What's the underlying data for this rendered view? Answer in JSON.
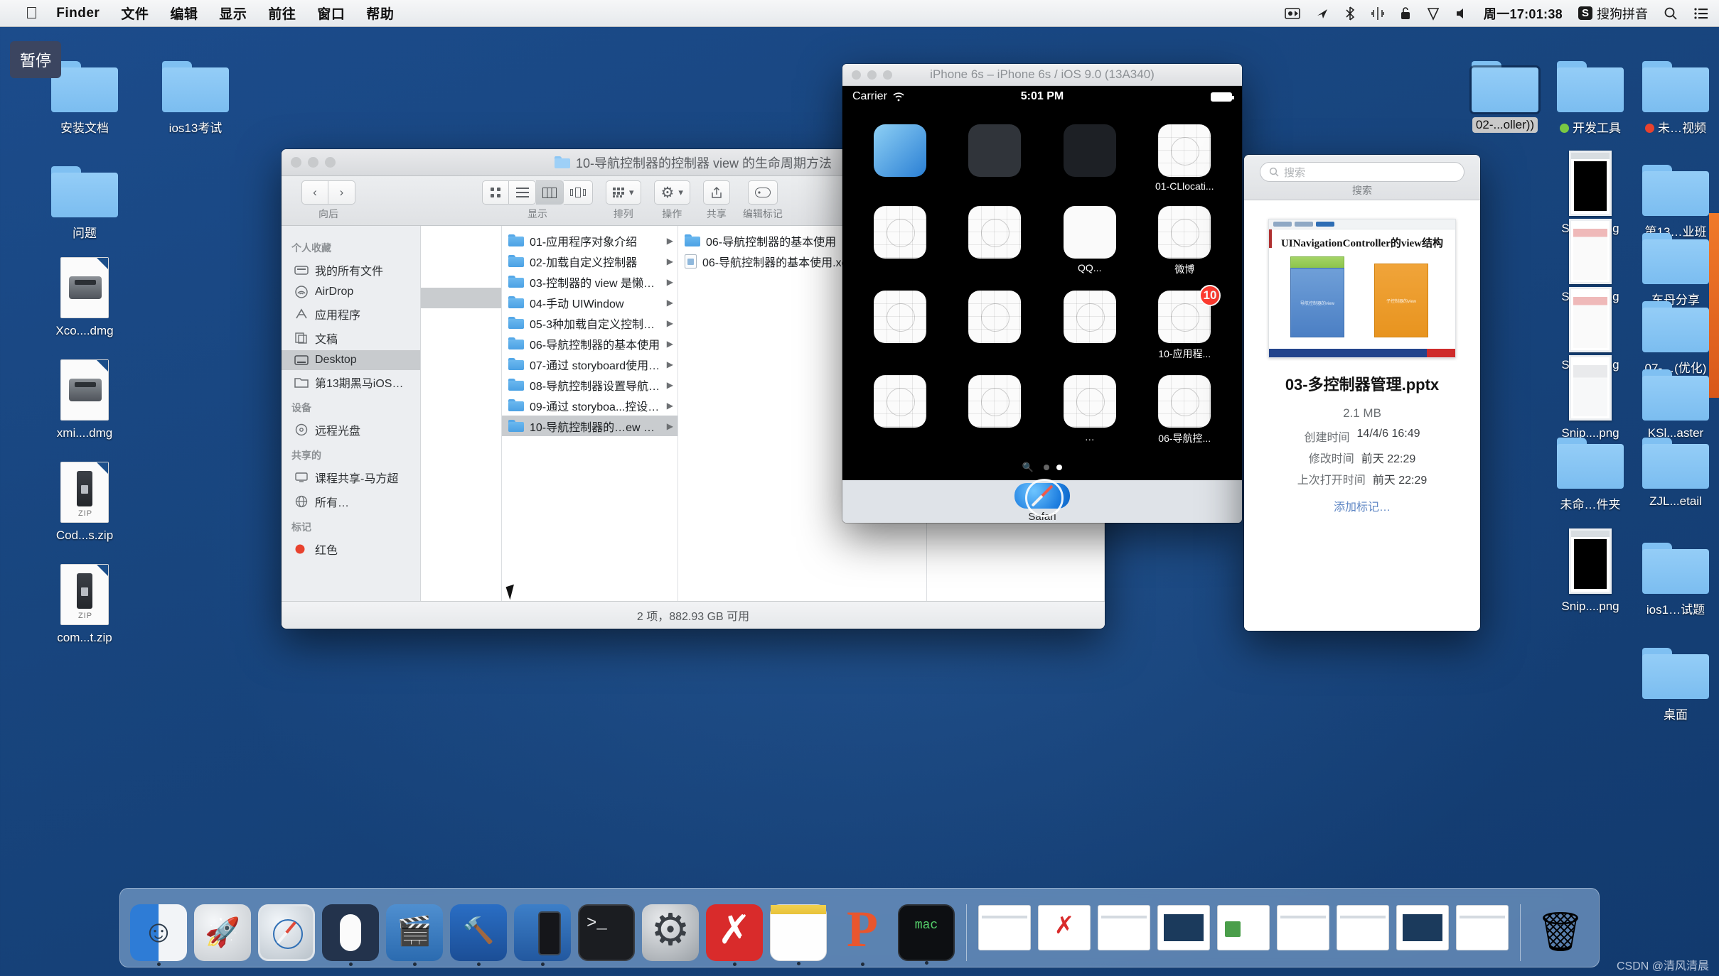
{
  "menubar": {
    "apple_icon": "apple-logo-icon",
    "items": [
      "Finder",
      "文件",
      "编辑",
      "显示",
      "前往",
      "窗口",
      "帮助"
    ],
    "right_icons": [
      "screen-recording-icon",
      "airplay-icon",
      "bluetooth-icon",
      "network-icon",
      "lock-icon",
      "vpn-shield-icon",
      "volume-icon"
    ],
    "clock": "周一17:01:38",
    "input_method_badge": "S",
    "input_method": "搜狗拼音",
    "search_icon": "search-icon",
    "control_center_icon": "control-center-icon"
  },
  "overlay": {
    "pause_label": "暂停"
  },
  "desktop": {
    "left_icons": [
      {
        "label": "安装文档",
        "type": "folder"
      },
      {
        "label": "ios13考试",
        "type": "folder"
      },
      {
        "label": "问题",
        "type": "folder"
      },
      {
        "label": "Xco....dmg",
        "type": "dmg"
      },
      {
        "label": "xmi....dmg",
        "type": "dmg"
      },
      {
        "label": "Cod...s.zip",
        "type": "zip"
      },
      {
        "label": "com...t.zip",
        "type": "zip"
      }
    ],
    "right_icons": [
      {
        "label": "02-...oller))",
        "type": "folder",
        "selected": true
      },
      {
        "label": "开发工具",
        "type": "folder",
        "tag_color": "#7ac943"
      },
      {
        "label": "未…视频",
        "type": "folder",
        "tag_color": "#e8422e"
      },
      {
        "label": "Snip....png",
        "type": "screenshot-black"
      },
      {
        "label": "第13…业班",
        "type": "folder"
      },
      {
        "label": "Snip....png",
        "type": "screenshot-red"
      },
      {
        "label": "车丹分享",
        "type": "folder"
      },
      {
        "label": "Snip....png",
        "type": "screenshot-red"
      },
      {
        "label": "07-…(优化)",
        "type": "folder"
      },
      {
        "label": "Snip....png",
        "type": "screenshot-gray"
      },
      {
        "label": "KSl...aster",
        "type": "folder"
      },
      {
        "label": "Snip....png",
        "type": "screenshot-black"
      },
      {
        "label": "ios1…试题",
        "type": "folder"
      },
      {
        "label": "桌面",
        "type": "folder"
      }
    ]
  },
  "finder": {
    "title": "10-导航控制器的控制器 view 的生命周期方法",
    "nav": {
      "back": "‹",
      "forward": "›",
      "label": "向后"
    },
    "toolbar": {
      "view_label": "显示",
      "view_modes": [
        "icon-view-icon",
        "list-view-icon",
        "column-view-icon",
        "coverflow-view-icon"
      ],
      "active_view": "column-view-icon",
      "arrange_label": "排列",
      "action_label": "操作",
      "share_label": "共享",
      "tags_label": "编辑标记",
      "search_placeholder": "搜索",
      "search_label": "搜索"
    },
    "sidebar": {
      "sections": [
        {
          "title": "个人收藏",
          "items": [
            {
              "label": "我的所有文件",
              "icon": "all-files-icon"
            },
            {
              "label": "AirDrop",
              "icon": "airdrop-icon"
            },
            {
              "label": "应用程序",
              "icon": "applications-icon"
            },
            {
              "label": "文稿",
              "icon": "documents-icon"
            },
            {
              "label": "Desktop",
              "icon": "desktop-icon",
              "selected": true
            },
            {
              "label": "第13期黑马iOS学科…",
              "icon": "folder-icon"
            }
          ]
        },
        {
          "title": "设备",
          "items": [
            {
              "label": "远程光盘",
              "icon": "remote-disc-icon"
            }
          ]
        },
        {
          "title": "共享的",
          "items": [
            {
              "label": "课程共享-马方超",
              "icon": "shared-mac-icon"
            },
            {
              "label": "所有…",
              "icon": "all-network-icon"
            }
          ]
        },
        {
          "title": "标记",
          "items": [
            {
              "label": "红色",
              "icon": "red-tag-icon"
            }
          ]
        }
      ]
    },
    "column_b": [
      {
        "label": "01-应用程序对象介绍",
        "type": "folder"
      },
      {
        "label": "02-加载自定义控制器",
        "type": "folder"
      },
      {
        "label": "03-控制器的 view 是懒加载",
        "type": "folder"
      },
      {
        "label": "04-手动 UIWindow",
        "type": "folder"
      },
      {
        "label": "05-3种加载自定义控制器的方式",
        "type": "folder"
      },
      {
        "label": "06-导航控制器的基本使用",
        "type": "folder"
      },
      {
        "label": "07-通过 storyboard使用导航控制器",
        "type": "folder"
      },
      {
        "label": "08-导航控制器设置导航栏内容",
        "type": "folder"
      },
      {
        "label": "09-通过 storyboa...控设置导航栏内容",
        "type": "folder"
      },
      {
        "label": "10-导航控制器的…ew 的生命周期方法",
        "type": "folder",
        "selected": true
      }
    ],
    "column_c": [
      {
        "label": "06-导航控制器的基本使用",
        "type": "folder"
      },
      {
        "label": "06-导航控制器的基本使用.xcodeproj",
        "type": "file"
      }
    ],
    "status": "2 项，882.93 GB 可用"
  },
  "simulator": {
    "title": "iPhone 6s – iPhone 6s / iOS 9.0 (13A340)",
    "status": {
      "carrier": "Carrier",
      "wifi_icon": "wifi-icon",
      "time": "5:01 PM",
      "battery_icon": "battery-icon"
    },
    "apps": [
      {
        "label": "",
        "kind": "safari-tile"
      },
      {
        "label": "",
        "kind": "dark-tile"
      },
      {
        "label": "",
        "kind": "headphones-tile"
      },
      {
        "label": "01-CLlocati...",
        "kind": "placeholder"
      },
      {
        "label": "",
        "kind": "placeholder"
      },
      {
        "label": "",
        "kind": "placeholder"
      },
      {
        "label": "QQ...",
        "kind": "qq-tile"
      },
      {
        "label": "微博",
        "kind": "placeholder"
      },
      {
        "label": "",
        "kind": "placeholder"
      },
      {
        "label": "",
        "kind": "placeholder"
      },
      {
        "label": "",
        "kind": "placeholder"
      },
      {
        "label": "10-应用程...",
        "kind": "placeholder",
        "badge": "10"
      },
      {
        "label": "",
        "kind": "placeholder"
      },
      {
        "label": "",
        "kind": "placeholder"
      },
      {
        "label": "…",
        "kind": "placeholder"
      },
      {
        "label": "06-导航控...",
        "kind": "placeholder"
      }
    ],
    "page_dots": {
      "count": 3,
      "active_index": 2,
      "search_icon": "spotlight-icon"
    },
    "dock": {
      "app_label": "Safari",
      "app_icon": "safari-icon"
    }
  },
  "preview": {
    "search_placeholder": "搜索",
    "search_label": "搜索",
    "slide": {
      "title": "UINavigationController的view结构"
    },
    "file_name": "03-多控制器管理.pptx",
    "file_size": "2.1 MB",
    "meta": [
      {
        "key": "创建时间",
        "value": "14/4/6 16:49"
      },
      {
        "key": "修改时间",
        "value": "前天 22:29"
      },
      {
        "key": "上次打开时间",
        "value": "前天 22:29"
      }
    ],
    "add_tag": "添加标记…"
  },
  "dock": {
    "items": [
      {
        "name": "finder",
        "icon": "finder-icon",
        "running": true
      },
      {
        "name": "launchpad",
        "icon": "launchpad-icon",
        "running": false
      },
      {
        "name": "safari",
        "icon": "safari-icon",
        "running": false
      },
      {
        "name": "magic-mouse",
        "icon": "mouse-utility-icon",
        "running": true
      },
      {
        "name": "quicktime",
        "icon": "quicktime-icon",
        "running": true
      },
      {
        "name": "xcode",
        "icon": "xcode-icon",
        "running": true
      },
      {
        "name": "simulator",
        "icon": "simulator-icon",
        "running": true
      },
      {
        "name": "terminal",
        "icon": "terminal-icon",
        "running": false
      },
      {
        "name": "system-preferences",
        "icon": "gear-icon",
        "running": false
      },
      {
        "name": "xmind",
        "icon": "xmind-icon",
        "running": true
      },
      {
        "name": "notes",
        "icon": "notes-icon",
        "running": true
      },
      {
        "name": "pdf-reader",
        "icon": "pdf-icon",
        "running": true
      },
      {
        "name": "console",
        "icon": "console-icon",
        "running": true
      }
    ],
    "minimized_count": 9,
    "trash_icon": "trash-icon"
  },
  "watermark": "CSDN @清风清晨"
}
